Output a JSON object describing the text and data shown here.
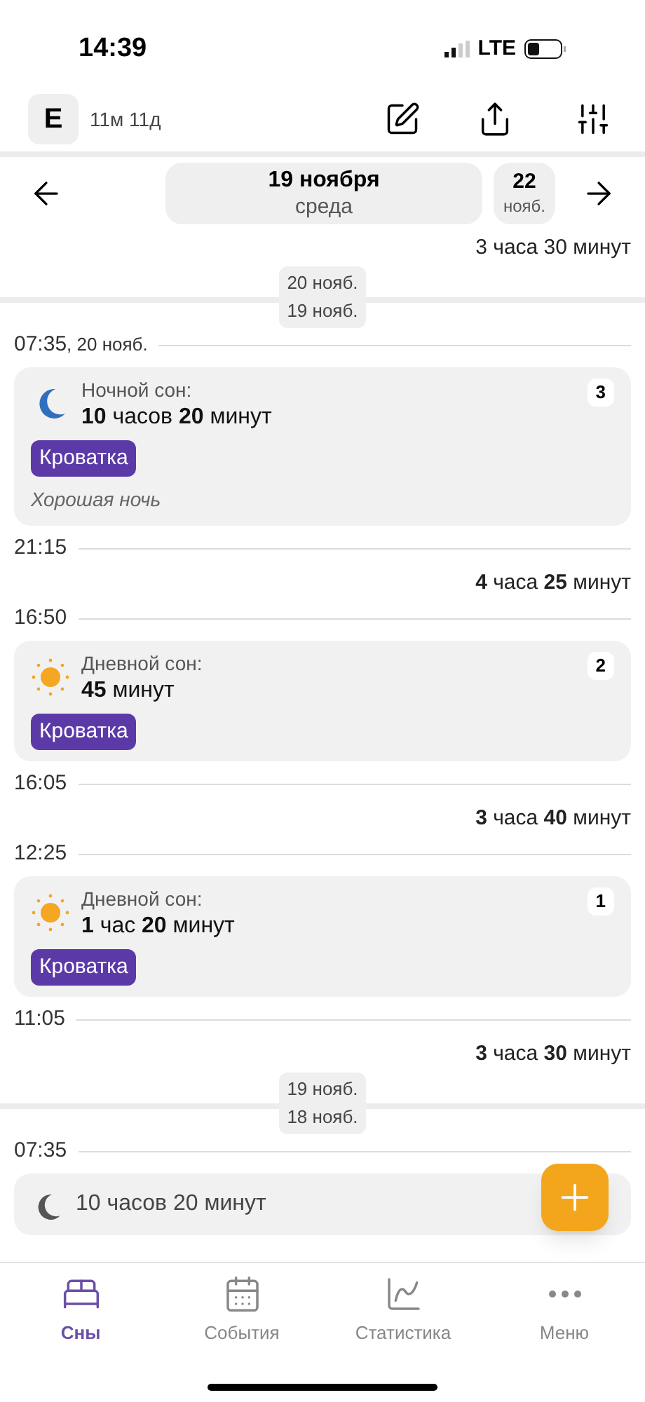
{
  "status_bar": {
    "time": "14:39",
    "network": "LTE"
  },
  "header": {
    "avatar": "E",
    "age": "11м 11д"
  },
  "date_nav": {
    "date": "19 ноября",
    "weekday": "среда",
    "next_day": "22",
    "next_month": "нояб."
  },
  "timeline": [
    {
      "kind": "gap",
      "text": "3 часа 30 минут"
    },
    {
      "kind": "day_divider",
      "top": "20 нояб.",
      "bottom": "19 нояб."
    },
    {
      "kind": "time",
      "time": "07:35",
      "suffix": ", 20 нояб."
    },
    {
      "kind": "night_sleep",
      "label": "Ночной сон:",
      "duration": "**10** часов **20** минут",
      "tag": "Кроватка",
      "note": "Хорошая ночь",
      "number": "3"
    },
    {
      "kind": "time",
      "time": "21:15"
    },
    {
      "kind": "gap",
      "text": "**4** часа **25** минут"
    },
    {
      "kind": "time",
      "time": "16:50"
    },
    {
      "kind": "day_sleep",
      "label": "Дневной сон:",
      "duration": "**45** минут",
      "tag": "Кроватка",
      "number": "2"
    },
    {
      "kind": "time",
      "time": "16:05"
    },
    {
      "kind": "gap",
      "text": "**3** часа **40** минут"
    },
    {
      "kind": "time",
      "time": "12:25"
    },
    {
      "kind": "day_sleep",
      "label": "Дневной сон:",
      "duration": "**1** час **20** минут",
      "tag": "Кроватка",
      "number": "1"
    },
    {
      "kind": "time",
      "time": "11:05"
    },
    {
      "kind": "gap",
      "text": "**3** часа **30** минут"
    },
    {
      "kind": "day_divider",
      "top": "19 нояб.",
      "bottom": "18 нояб."
    },
    {
      "kind": "time",
      "time": "07:35"
    },
    {
      "kind": "night_sleep",
      "duration": "10 часов 20 минут"
    }
  ],
  "tabs": [
    {
      "label": "Сны",
      "selected": true
    },
    {
      "label": "События",
      "selected": false
    },
    {
      "label": "Статистика",
      "selected": false
    },
    {
      "label": "Меню",
      "selected": false
    }
  ]
}
